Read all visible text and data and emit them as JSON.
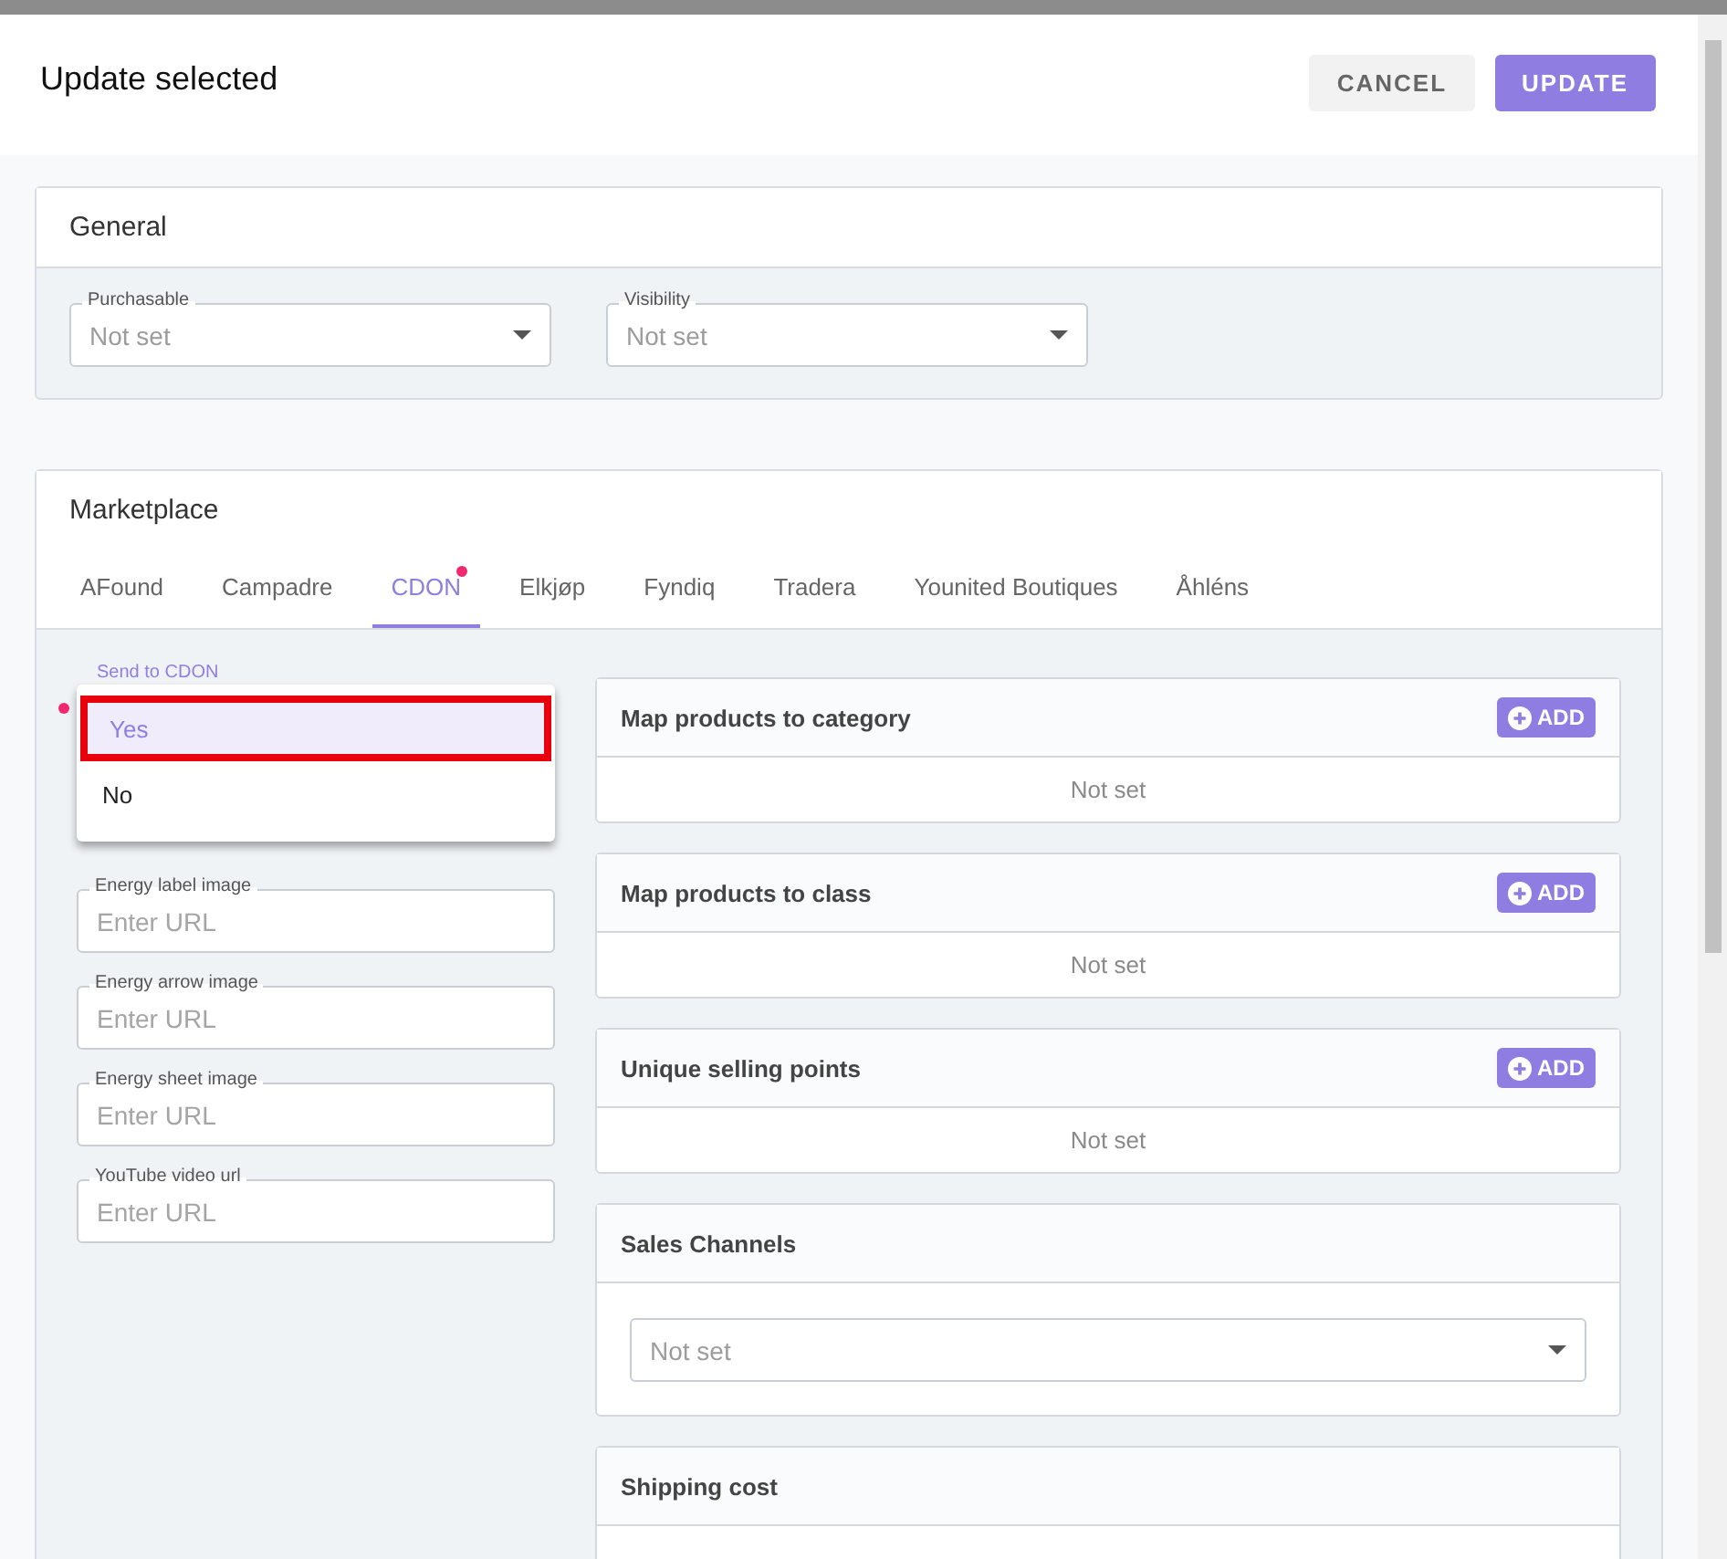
{
  "window": {
    "title": "Update selected"
  },
  "actions": [
    {
      "label": "CANCEL",
      "kind": "secondary"
    },
    {
      "label": "UPDATE",
      "kind": "primary"
    }
  ],
  "general": {
    "title": "General",
    "fields": [
      {
        "label": "Purchasable",
        "value": "Not set"
      },
      {
        "label": "Visibility",
        "value": "Not set"
      }
    ]
  },
  "marketplace": {
    "title": "Marketplace",
    "tabs": [
      {
        "label": "AFound",
        "selected": false,
        "changed": false
      },
      {
        "label": "Campadre",
        "selected": false,
        "changed": false
      },
      {
        "label": "CDON",
        "selected": true,
        "changed": true
      },
      {
        "label": "Elkjøp",
        "selected": false,
        "changed": false
      },
      {
        "label": "Fyndiq",
        "selected": false,
        "changed": false
      },
      {
        "label": "Tradera",
        "selected": false,
        "changed": false
      },
      {
        "label": "Younited Boutiques",
        "selected": false,
        "changed": false
      },
      {
        "label": "Åhléns",
        "selected": false,
        "changed": false
      }
    ],
    "send_field": {
      "label": "Send to CDON",
      "changed": true,
      "options": [
        {
          "label": "Yes",
          "selected": true,
          "highlighted": true
        },
        {
          "label": "No",
          "selected": false,
          "highlighted": false
        }
      ]
    },
    "url_fields": [
      {
        "label": "Energy label image",
        "placeholder": "Enter URL"
      },
      {
        "label": "Energy arrow image",
        "placeholder": "Enter URL"
      },
      {
        "label": "Energy sheet image",
        "placeholder": "Enter URL"
      },
      {
        "label": "YouTube video url",
        "placeholder": "Enter URL"
      }
    ],
    "panels": [
      {
        "title": "Map products to category",
        "kind": "list",
        "button": "ADD",
        "empty": "Not set"
      },
      {
        "title": "Map products to class",
        "kind": "list",
        "button": "ADD",
        "empty": "Not set"
      },
      {
        "title": "Unique selling points",
        "kind": "list",
        "button": "ADD",
        "empty": "Not set"
      },
      {
        "title": "Sales Channels",
        "kind": "select",
        "value": "Not set"
      },
      {
        "title": "Shipping cost",
        "kind": "cut"
      }
    ]
  }
}
